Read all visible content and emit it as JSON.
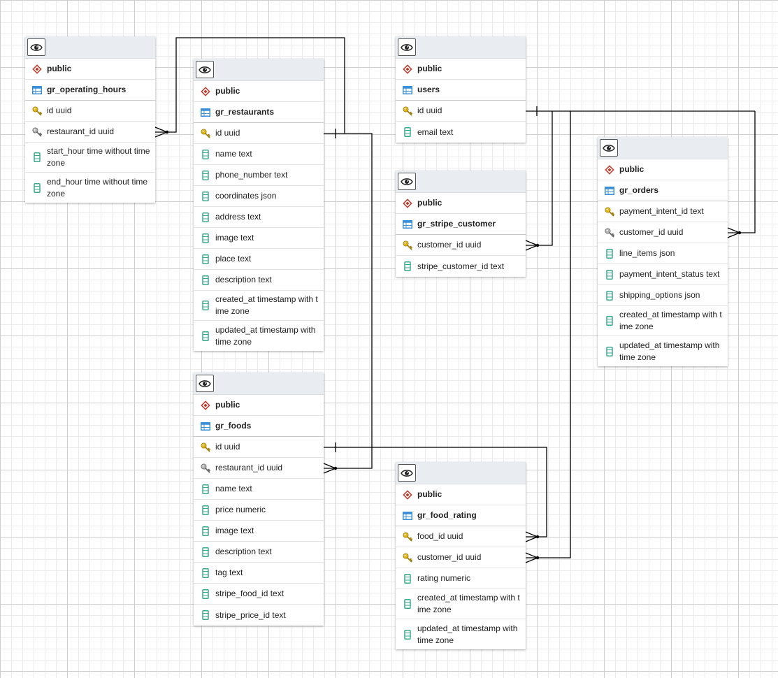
{
  "tables": [
    {
      "id": "gr_operating_hours",
      "schema": "public",
      "name": "gr_operating_hours",
      "columns": [
        {
          "icon": "primary-key-icon",
          "text": "id uuid"
        },
        {
          "icon": "foreign-key-icon",
          "text": "restaurant_id uuid"
        },
        {
          "icon": "column-icon",
          "text": "start_hour time without time zone"
        },
        {
          "icon": "column-icon",
          "text": "end_hour time without time zone"
        }
      ]
    },
    {
      "id": "gr_restaurants",
      "schema": "public",
      "name": "gr_restaurants",
      "columns": [
        {
          "icon": "primary-key-icon",
          "text": "id uuid"
        },
        {
          "icon": "column-icon",
          "text": "name text"
        },
        {
          "icon": "column-icon",
          "text": "phone_number text"
        },
        {
          "icon": "column-icon",
          "text": "coordinates json"
        },
        {
          "icon": "column-icon",
          "text": "address text"
        },
        {
          "icon": "column-icon",
          "text": "image text"
        },
        {
          "icon": "column-icon",
          "text": "place text"
        },
        {
          "icon": "column-icon",
          "text": "description text"
        },
        {
          "icon": "column-icon",
          "text": "created_at timestamp with time zone"
        },
        {
          "icon": "column-icon",
          "text": "updated_at timestamp with time zone"
        }
      ]
    },
    {
      "id": "users",
      "schema": "public",
      "name": "users",
      "columns": [
        {
          "icon": "primary-key-icon",
          "text": "id uuid"
        },
        {
          "icon": "column-icon",
          "text": "email text"
        }
      ]
    },
    {
      "id": "gr_stripe_customer",
      "schema": "public",
      "name": "gr_stripe_customer",
      "columns": [
        {
          "icon": "primary-key-icon",
          "text": "customer_id uuid"
        },
        {
          "icon": "column-icon",
          "text": "stripe_customer_id text"
        }
      ]
    },
    {
      "id": "gr_orders",
      "schema": "public",
      "name": "gr_orders",
      "columns": [
        {
          "icon": "primary-key-icon",
          "text": "payment_intent_id text"
        },
        {
          "icon": "foreign-key-icon",
          "text": "customer_id uuid"
        },
        {
          "icon": "column-icon",
          "text": "line_items json"
        },
        {
          "icon": "column-icon",
          "text": "payment_intent_status text"
        },
        {
          "icon": "column-icon",
          "text": "shipping_options json"
        },
        {
          "icon": "column-icon",
          "text": "created_at timestamp with time zone"
        },
        {
          "icon": "column-icon",
          "text": "updated_at timestamp with time zone"
        }
      ]
    },
    {
      "id": "gr_foods",
      "schema": "public",
      "name": "gr_foods",
      "columns": [
        {
          "icon": "primary-key-icon",
          "text": "id uuid"
        },
        {
          "icon": "foreign-key-icon",
          "text": "restaurant_id uuid"
        },
        {
          "icon": "column-icon",
          "text": "name text"
        },
        {
          "icon": "column-icon",
          "text": "price numeric"
        },
        {
          "icon": "column-icon",
          "text": "image text"
        },
        {
          "icon": "column-icon",
          "text": "description text"
        },
        {
          "icon": "column-icon",
          "text": "tag text"
        },
        {
          "icon": "column-icon",
          "text": "stripe_food_id text"
        },
        {
          "icon": "column-icon",
          "text": "stripe_price_id text"
        }
      ]
    },
    {
      "id": "gr_food_rating",
      "schema": "public",
      "name": "gr_food_rating",
      "columns": [
        {
          "icon": "primary-key-icon",
          "text": "food_id uuid"
        },
        {
          "icon": "primary-key-icon",
          "text": "customer_id uuid"
        },
        {
          "icon": "column-icon",
          "text": "rating numeric"
        },
        {
          "icon": "column-icon",
          "text": "created_at timestamp with time zone"
        },
        {
          "icon": "column-icon",
          "text": "updated_at timestamp with time zone"
        }
      ]
    }
  ],
  "relationships": [
    {
      "from": "gr_operating_hours.restaurant_id",
      "to": "gr_restaurants.id",
      "cardinality": "many-to-one"
    },
    {
      "from": "gr_foods.restaurant_id",
      "to": "gr_restaurants.id",
      "cardinality": "many-to-one"
    },
    {
      "from": "gr_stripe_customer.customer_id",
      "to": "users.id",
      "cardinality": "many-to-one"
    },
    {
      "from": "gr_orders.customer_id",
      "to": "users.id",
      "cardinality": "many-to-one"
    },
    {
      "from": "gr_food_rating.customer_id",
      "to": "users.id",
      "cardinality": "many-to-one"
    },
    {
      "from": "gr_food_rating.food_id",
      "to": "gr_foods.id",
      "cardinality": "many-to-one"
    }
  ],
  "colors": {
    "schema_icon": "#c0392b",
    "table_icon": "#3a8fd6",
    "key_icon": "#e2b619",
    "column_icon": "#3aa88f",
    "line": "#000000"
  }
}
